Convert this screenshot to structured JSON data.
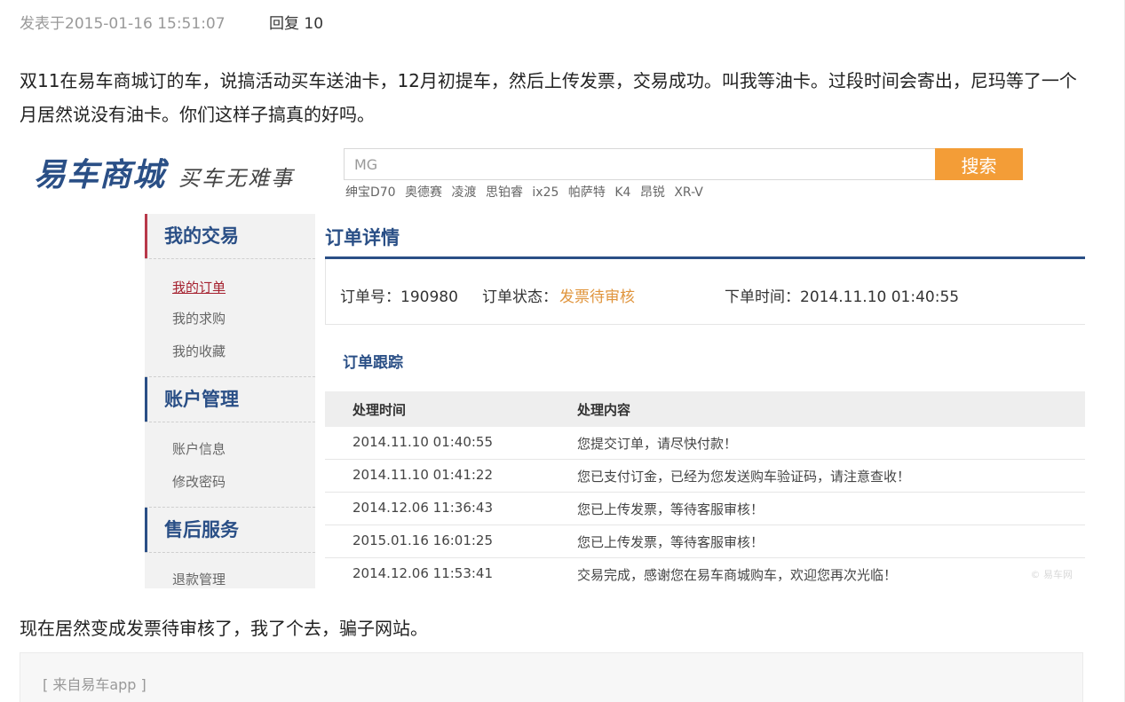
{
  "post": {
    "posted_at": "发表于2015-01-16 15:51:07",
    "reply": "回复 10",
    "paragraph1": "双11在易车商城订的车，说搞活动买车送油卡，12月初提车，然后上传发票，交易成功。叫我等油卡。过段时间会寄出，尼玛等了一个月居然说没有油卡。你们这样子搞真的好吗。",
    "paragraph2": "现在居然变成发票待审核了，我了个去，骗子网站。",
    "source": "[ 来自易车app ]"
  },
  "screenshot": {
    "logo": "易车商城",
    "slogan": "买车无难事",
    "search": {
      "value": "MG",
      "button": "搜索"
    },
    "hot_words": [
      "绅宝D70",
      "奥德赛",
      "凌渡",
      "思铂睿",
      "ix25",
      "帕萨特",
      "K4",
      "昂锐",
      "XR-V"
    ],
    "sidebar": {
      "sections": [
        {
          "title": "我的交易",
          "items": [
            "我的订单",
            "我的求购",
            "我的收藏"
          ]
        },
        {
          "title": "账户管理",
          "items": [
            "账户信息",
            "修改密码"
          ]
        },
        {
          "title": "售后服务",
          "items": [
            "退款管理"
          ]
        }
      ]
    },
    "order": {
      "title": "订单详情",
      "number": "订单号：190980",
      "status_label": "订单状态：",
      "status_value": "发票待审核",
      "time": "下单时间：2014.11.10 01:40:55"
    },
    "tracking": {
      "title": "订单跟踪",
      "headers": [
        "处理时间",
        "处理内容"
      ],
      "rows": [
        {
          "time": "2014.11.10 01:40:55",
          "content": "您提交订单，请尽快付款！"
        },
        {
          "time": "2014.11.10 01:41:22",
          "content": "您已支付订金，已经为您发送购车验证码，请注意查收！"
        },
        {
          "time": "2014.12.06 11:36:43",
          "content": "您已上传发票，等待客服审核！"
        },
        {
          "time": "2015.01.16 16:01:25",
          "content": "您已上传发票，等待客服审核！"
        },
        {
          "time": "2014.12.06 11:53:41",
          "content": "交易完成，感谢您在易车商城购车，欢迎您再次光临！"
        }
      ]
    },
    "watermark": "© 易车网"
  }
}
